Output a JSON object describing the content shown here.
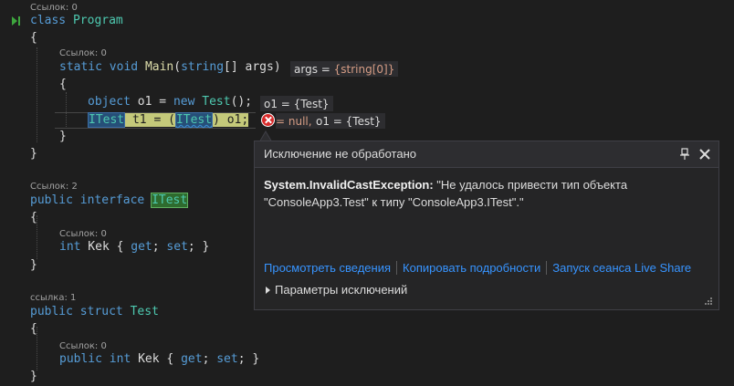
{
  "refs": {
    "class_program": "Ссылок: 0",
    "main": "Ссылок: 0",
    "interface": "Ссылок: 2",
    "interface_kek": "Ссылок: 0",
    "struct": "ссылка: 1",
    "struct_kek": "Ссылок: 0"
  },
  "code": {
    "class_kw": "class",
    "class_name": "Program",
    "brace_open": "{",
    "brace_close": "}",
    "main_static": "static",
    "main_void": "void",
    "main_name": "Main",
    "main_params_open": "(",
    "main_param_type": "string",
    "main_params_rest": "[] args)",
    "o1_kw": "object",
    "o1_rest": "o1 = ",
    "o1_new": "new",
    "o1_type": "Test",
    "o1_end": "();",
    "t1_type": "ITest",
    "t1_mid": " t1 = (",
    "t1_cast": "ITest",
    "t1_end": ") o1;",
    "public_kw": "public",
    "interface_kw": "interface",
    "interface_name": "ITest",
    "int_kw": "int",
    "kek_decl": " Kek { ",
    "get_kw": "get",
    "semi_space": "; ",
    "set_kw": "set",
    "close_prop": "; }",
    "struct_kw": "struct",
    "struct_name": "Test"
  },
  "datatips": {
    "args_label": "args = ",
    "args_value": "{string[0]}",
    "o1_first": "o1 = {Test}",
    "t1_null": "= null,",
    "o1_second": "o1 = {Test}"
  },
  "exception": {
    "title": "Исключение не обработано",
    "type": "System.InvalidCastException:",
    "message": " \"Не удалось привести тип объекта \"ConsoleApp3.Test\" к типу \"ConsoleApp3.ITest\".\"",
    "link_details": "Просмотреть сведения",
    "link_copy": "Копировать подробности",
    "link_liveshare": "Запуск сеанса Live Share",
    "params": "Параметры исключений"
  },
  "colors": {
    "background": "#1e1e1e",
    "keyword": "#569cd6",
    "type": "#4ec9b0",
    "method": "#dcdcaa",
    "link": "#3794ff",
    "error": "#d72a2a"
  }
}
